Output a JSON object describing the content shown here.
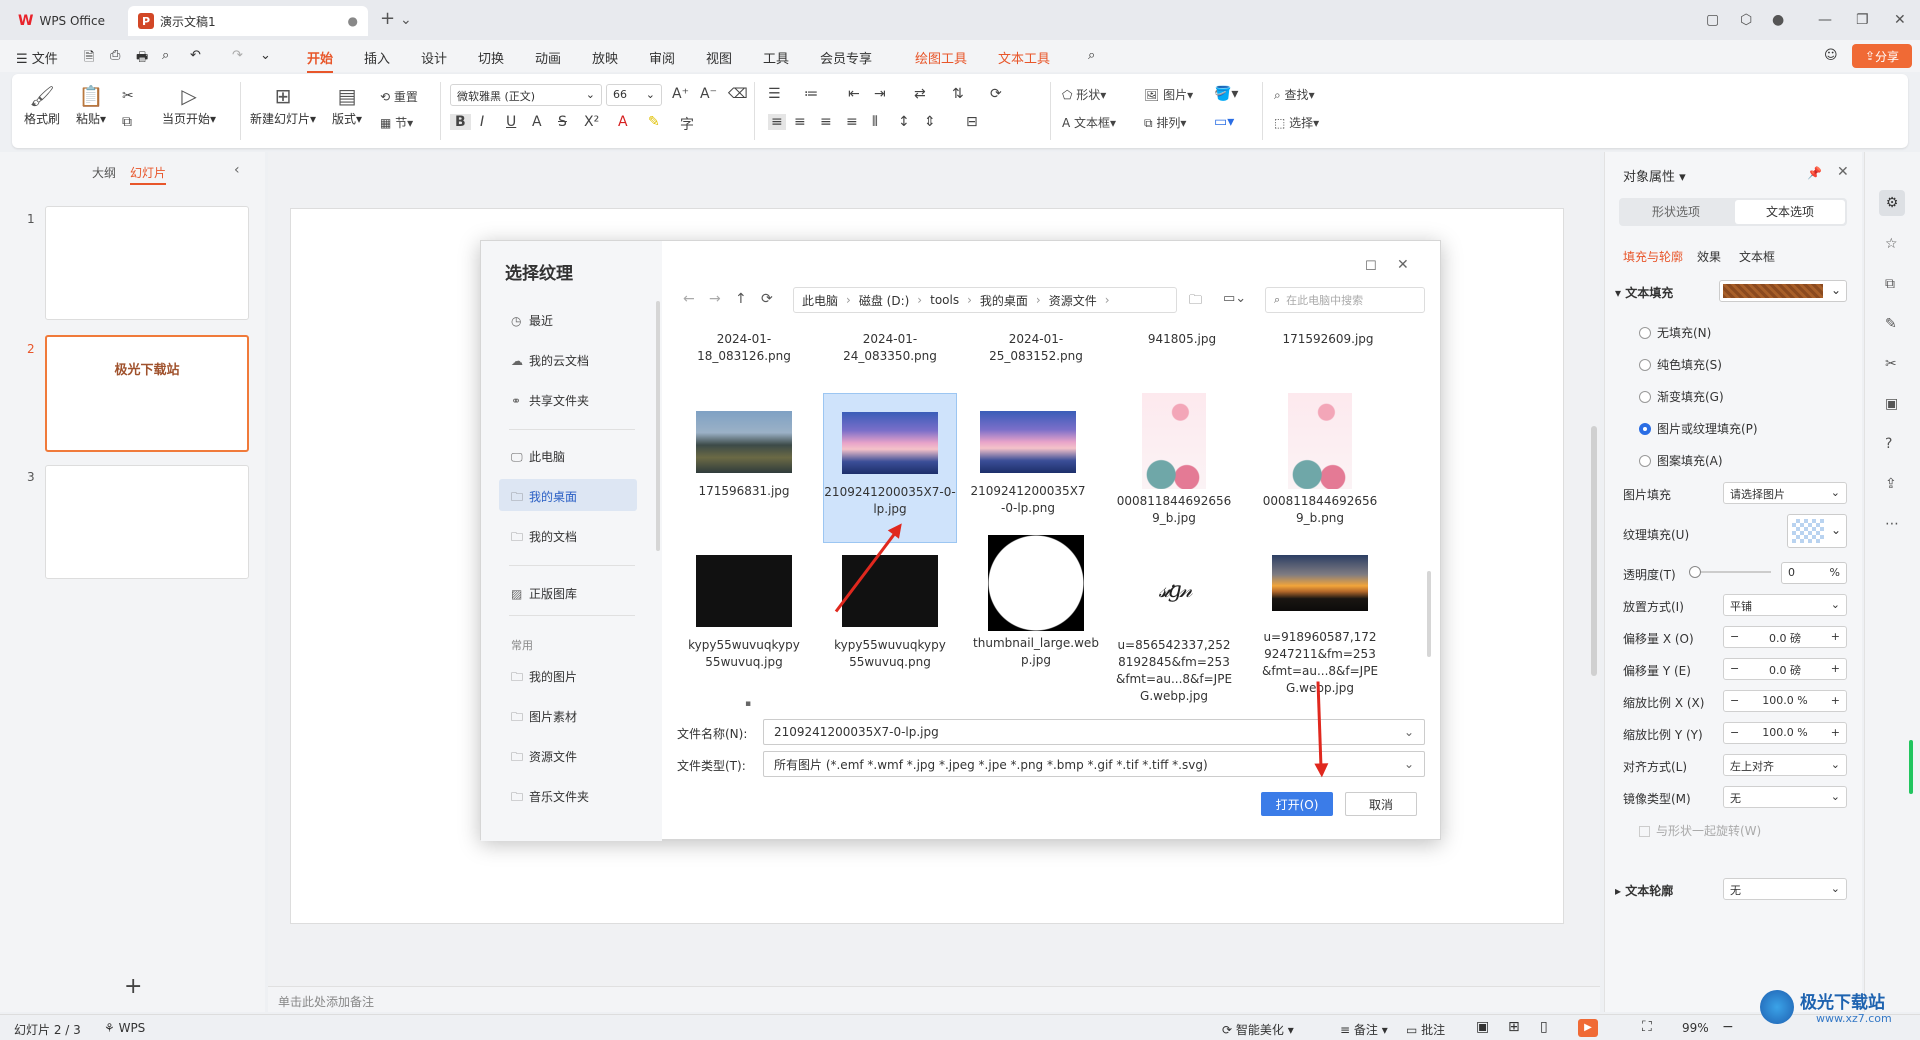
{
  "titlebar": {
    "app_tab": "WPS Office",
    "doc_tab": "演示文稿1"
  },
  "menu": {
    "file": "文件",
    "items": [
      "开始",
      "插入",
      "设计",
      "切换",
      "动画",
      "放映",
      "审阅",
      "视图",
      "工具",
      "会员专享"
    ],
    "context": [
      "绘图工具",
      "文本工具"
    ],
    "share": "分享"
  },
  "ribbon": {
    "format_painter": "格式刷",
    "paste": "粘贴",
    "start_from_current": "当页开始",
    "new_slide": "新建幻灯片",
    "layout": "版式",
    "section": "节",
    "reset": "重置",
    "font_name": "微软雅黑 (正文)",
    "font_size": "66",
    "shape": "形状",
    "picture": "图片",
    "textbox": "文本框",
    "arrange": "排列",
    "find": "查找",
    "select": "选择"
  },
  "leftpanel": {
    "tab_outline": "大纲",
    "tab_slides": "幻灯片",
    "slides": [
      {
        "num": "1",
        "text": ""
      },
      {
        "num": "2",
        "text": "极光下载站"
      },
      {
        "num": "3",
        "text": ""
      }
    ],
    "add": "+"
  },
  "notes": {
    "placeholder": "单击此处添加备注"
  },
  "rightpanel": {
    "title": "对象属性",
    "tab_shape": "形状选项",
    "tab_text": "文本选项",
    "subtabs": [
      "填充与轮廓",
      "效果",
      "文本框"
    ],
    "text_fill": "文本填充",
    "options": [
      "无填充(N)",
      "纯色填充(S)",
      "渐变填充(G)",
      "图片或纹理填充(P)",
      "图案填充(A)"
    ],
    "picture_fill_label": "图片填充",
    "picture_fill_value": "请选择图片",
    "texture_fill_label": "纹理填充(U)",
    "transparency_label": "透明度(T)",
    "transparency_value": "0",
    "percent": "%",
    "place_label": "放置方式(I)",
    "place_value": "平铺",
    "offset_x_label": "偏移量 X (O)",
    "offset_x_value": "0.0",
    "offset_unit": "磅",
    "offset_y_label": "偏移量 Y (E)",
    "offset_y_value": "0.0",
    "scale_x_label": "缩放比例 X (X)",
    "scale_x_value": "100.0",
    "scale_y_label": "缩放比例 Y (Y)",
    "scale_y_value": "100.0",
    "align_label": "对齐方式(L)",
    "align_value": "左上对齐",
    "mirror_label": "镜像类型(M)",
    "mirror_value": "无",
    "rotate_with_shape": "与形状一起旋转(W)",
    "text_outline": "文本轮廓",
    "text_outline_value": "无"
  },
  "dialog": {
    "title": "选择纹理",
    "nav": [
      {
        "icon": "clock-icon",
        "label": "最近"
      },
      {
        "icon": "cloud-icon",
        "label": "我的云文档"
      },
      {
        "icon": "share-icon",
        "label": "共享文件夹"
      },
      {
        "icon": "computer-icon",
        "label": "此电脑"
      },
      {
        "icon": "folder-icon",
        "label": "我的桌面"
      },
      {
        "icon": "folder-icon",
        "label": "我的文档"
      },
      {
        "icon": "gallery-icon",
        "label": "正版图库"
      },
      {
        "icon": "folder-icon",
        "label": "我的图片"
      },
      {
        "icon": "folder-icon",
        "label": "图片素材"
      },
      {
        "icon": "folder-icon",
        "label": "资源文件"
      },
      {
        "icon": "folder-icon",
        "label": "音乐文件夹"
      }
    ],
    "section_common": "常用",
    "breadcrumb": [
      "此电脑",
      "磁盘 (D:)",
      "tools",
      "我的桌面",
      "资源文件"
    ],
    "search_placeholder": "在此电脑中搜索",
    "top_row": [
      "2024-01-18_083126.png",
      "2024-01-24_083350.png",
      "2024-01-25_083152.png",
      "941805.jpg",
      "171592609.jpg"
    ],
    "files": [
      {
        "name": "171596831.jpg",
        "kind": "city"
      },
      {
        "name": "2109241200035X7-0-lp.jpg",
        "kind": "sunset-purple"
      },
      {
        "name": "2109241200035X7-0-lp.png",
        "kind": "sunset-purple"
      },
      {
        "name": "0008118446926569_b.jpg",
        "kind": "pink-flowers"
      },
      {
        "name": "0008118446926569_b.png",
        "kind": "pink-flowers"
      },
      {
        "name": "kypy55wuvuqkypy55wuvuq.jpg",
        "kind": "dark"
      },
      {
        "name": "kypy55wuvuqkypy55wuvuq.png",
        "kind": "dark"
      },
      {
        "name": "thumbnail_large.webp.jpg",
        "kind": "circle"
      },
      {
        "name": "u=856542337,2528192845&fm=253&fmt=au...8&f=JPEG.webp.jpg",
        "kind": "signature"
      },
      {
        "name": "u=918960587,1729247211&fm=253&fmt=au...8&f=JPEG.webp.jpg",
        "kind": "sunset-orange"
      }
    ],
    "filename_label": "文件名称(N):",
    "filename_value": "2109241200035X7-0-lp.jpg",
    "filetype_label": "文件类型(T):",
    "filetype_value": "所有图片 (*.emf *.wmf *.jpg *.jpeg *.jpe *.png *.bmp *.gif *.tif *.tiff *.svg)",
    "open": "打开(O)",
    "cancel": "取消"
  },
  "statusbar": {
    "slide_info": "幻灯片 2 / 3",
    "theme": "WPS",
    "beautify": "智能美化",
    "notes": "备注",
    "comments": "批注",
    "zoom": "99%"
  },
  "watermark": "极光下载站",
  "watermark_url": "www.xz7.com",
  "colors": {
    "accent": "#e8562a",
    "selection": "#2a6de4",
    "arrow": "#e0281e"
  }
}
